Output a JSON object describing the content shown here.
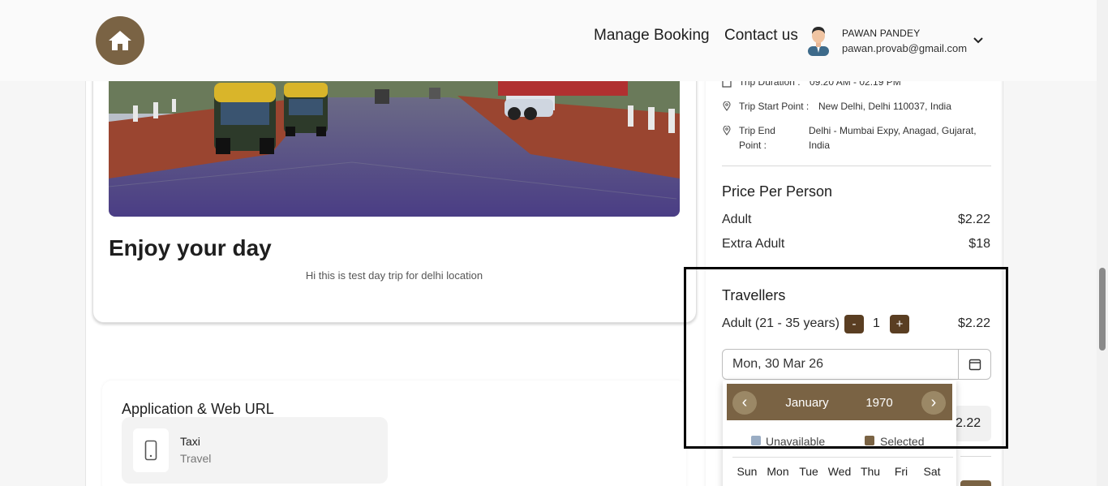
{
  "header": {
    "nav": [
      "Manage Booking",
      "Contact us"
    ],
    "user": {
      "name": "PAWAN PANDEY",
      "email": "pawan.provab@gmail.com"
    }
  },
  "trip": {
    "title": "Enjoy your day",
    "description": "Hi this is test day trip for delhi location"
  },
  "app_section": {
    "title": "Application & Web URL",
    "item_name": "Taxi",
    "item_sub": "Travel"
  },
  "details": {
    "duration_label": "Trip Duration :",
    "duration_value": "09:20 AM - 02:19 PM",
    "start_label": "Trip Start Point :",
    "start_value": "New Delhi, Delhi 110037, India",
    "end_label_1": "Trip End",
    "end_label_2": "Point :",
    "end_value_1": "Delhi - Mumbai Expy, Anagad, Gujarat,",
    "end_value_2": "India"
  },
  "pricing": {
    "title": "Price Per Person",
    "rows": [
      {
        "label": "Adult",
        "value": "$2.22"
      },
      {
        "label": "Extra Adult",
        "value": "$18"
      }
    ]
  },
  "travellers": {
    "title": "Travellers",
    "adult_label": "Adult (21 - 35 years)",
    "minus": "-",
    "count": "1",
    "plus": "+",
    "price": "$2.22",
    "total_partial": "2.22"
  },
  "date": {
    "value": "Mon, 30 Mar 26"
  },
  "datepicker": {
    "prev": "‹",
    "next": "›",
    "month": "January",
    "year": "1970",
    "legend": [
      "Unavailable",
      "Selected"
    ],
    "weekdays": [
      "Sun",
      "Mon",
      "Tue",
      "Wed",
      "Thu",
      "Fri",
      "Sat"
    ]
  },
  "colors": {
    "brand": "#7a6344",
    "button": "#5a3e22",
    "unavailable": "#9aadc4"
  },
  "icons": [
    "home-icon",
    "chevron-down-icon",
    "clock-icon",
    "location-pin-icon",
    "phone-icon",
    "calendar-icon"
  ]
}
